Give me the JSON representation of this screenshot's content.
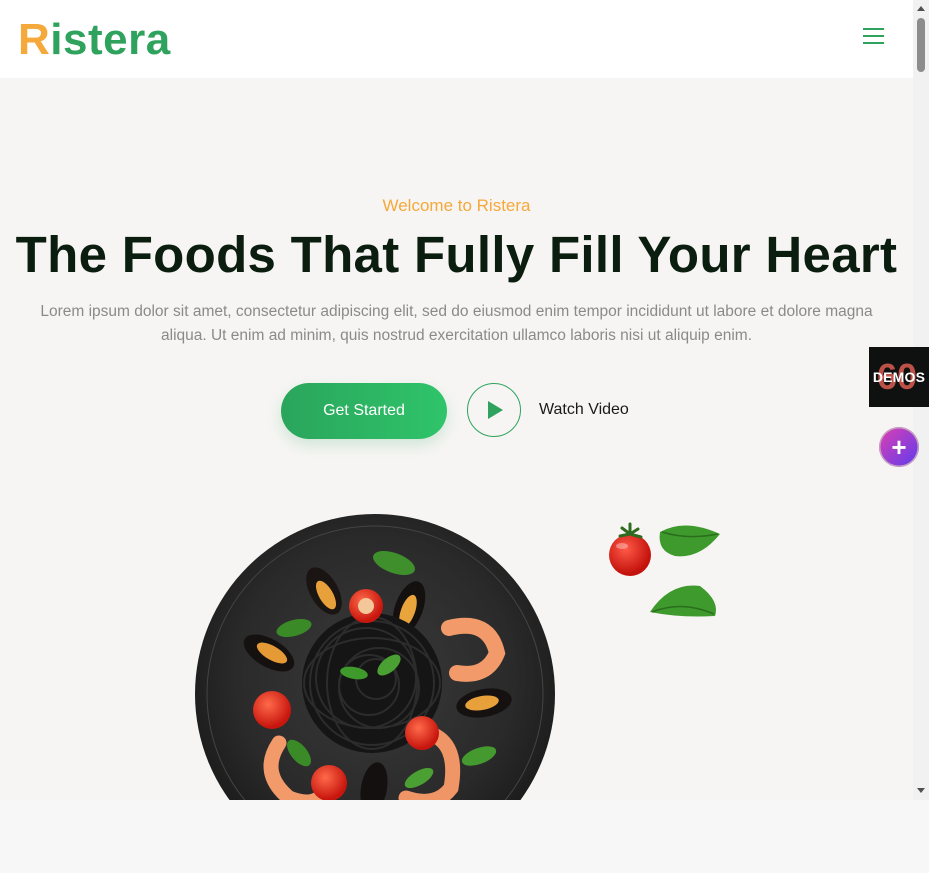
{
  "header": {
    "logo_first_letter": "R",
    "logo_rest": "istera",
    "menu_icon": "hamburger-menu-icon"
  },
  "hero": {
    "subtitle": "Welcome to Ristera",
    "title": "The Foods That Fully Fill Your Heart",
    "description": "Lorem ipsum dolor sit amet, consectetur adipiscing elit, sed do eiusmod enim tempor incididunt ut labore et dolore magna aliqua. Ut enim ad minim, quis nostrud exercitation ullamco laboris nisi ut aliquip enim.",
    "primary_button": "Get Started",
    "video_button_icon": "play-icon",
    "video_label": "Watch Video"
  },
  "side_widgets": {
    "demos_count": "60",
    "demos_label": "DEMOS",
    "plus_label": "+"
  },
  "colors": {
    "brand_green": "#2fa35d",
    "brand_orange": "#f5a93a",
    "title_dark": "#0b1d0f",
    "hero_background": "#f6f5f3"
  }
}
